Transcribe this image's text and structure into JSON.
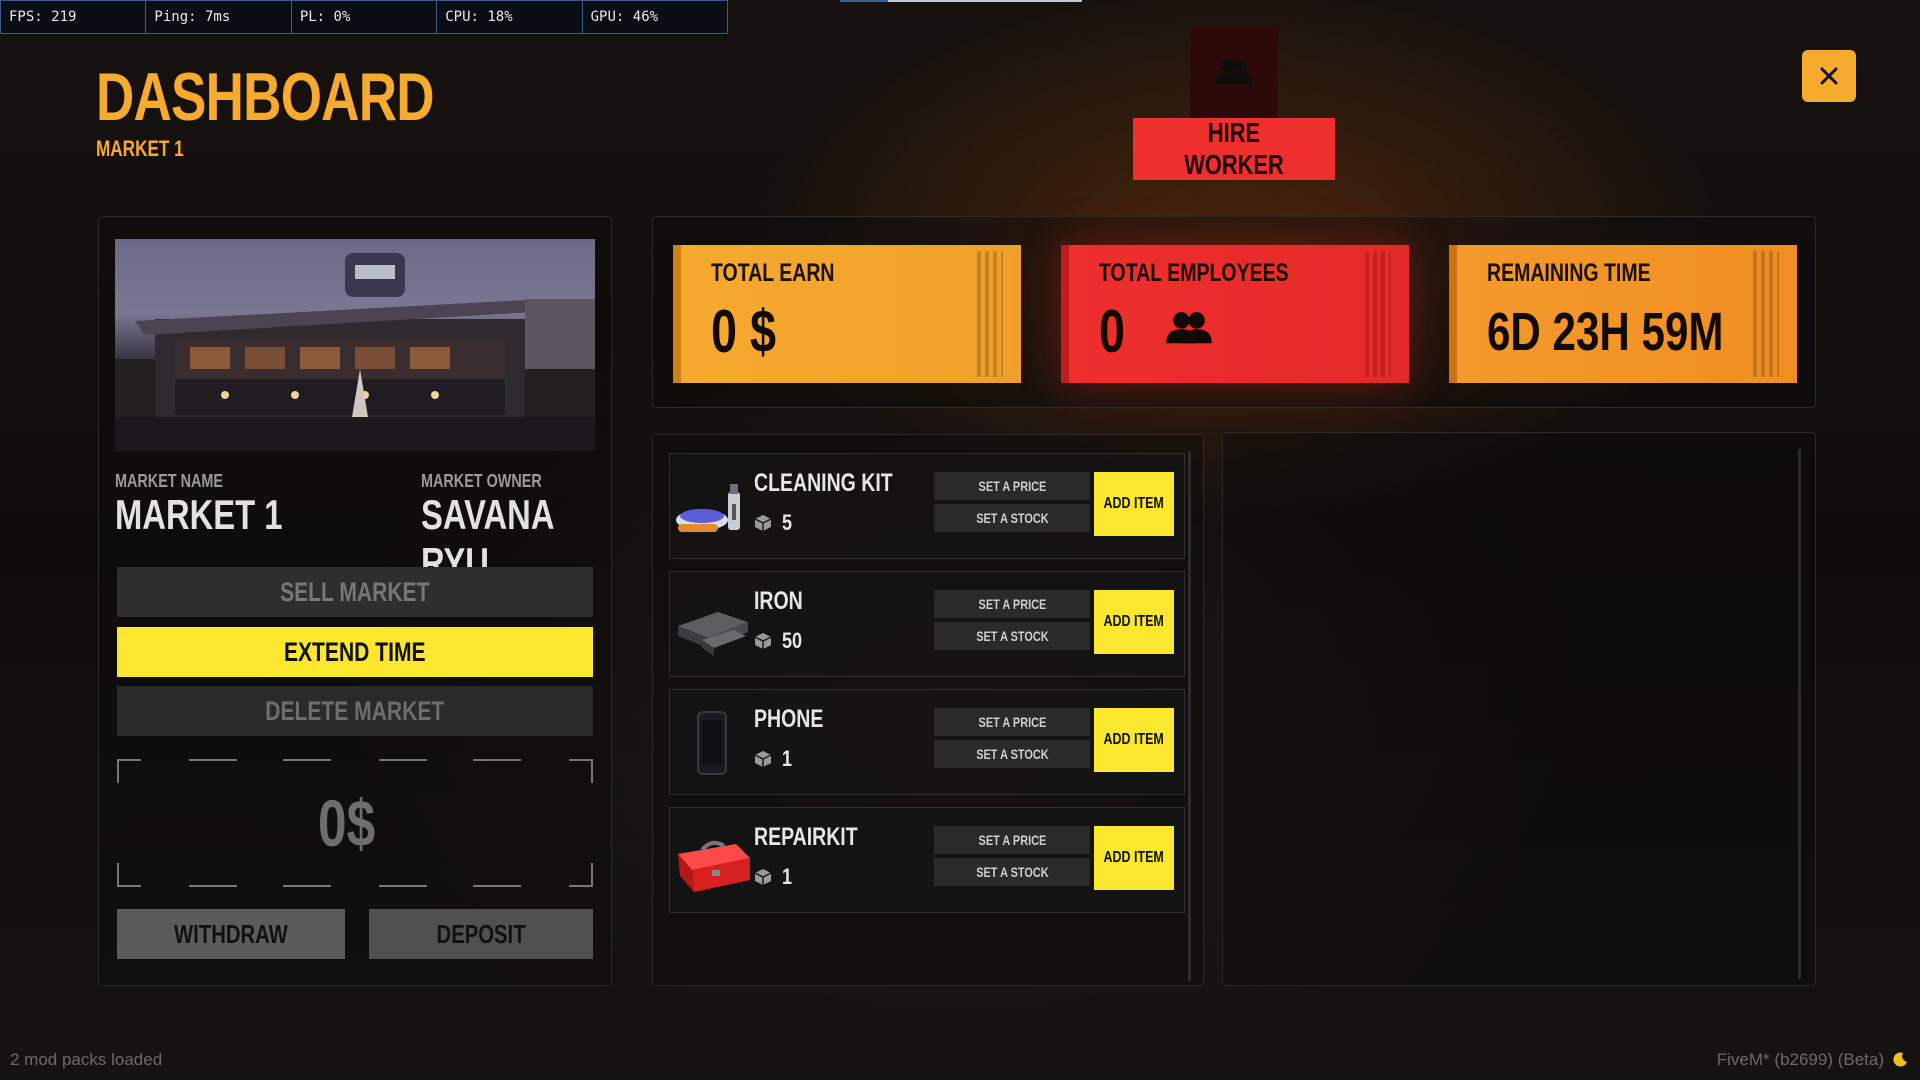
{
  "perf": {
    "fps": "FPS: 219",
    "ping": "Ping: 7ms",
    "pl": "PL: 0%",
    "cpu": "CPU: 18%",
    "gpu": "GPU: 46%"
  },
  "header": {
    "title": "DASHBOARD",
    "subtitle": "MARKET 1",
    "hire_label": "HIRE WORKER"
  },
  "market": {
    "name_label": "MARKET NAME",
    "name": "MARKET 1",
    "owner_label": "MARKET OWNER",
    "owner": "SAVANA RYU",
    "sell_label": "SELL MARKET",
    "extend_label": "EXTEND TIME",
    "delete_label": "DELETE MARKET",
    "balance": "0$",
    "withdraw_label": "WITHDRAW",
    "deposit_label": "DEPOSIT"
  },
  "stats": {
    "earn_label": "TOTAL EARN",
    "earn_value": "0 $",
    "employees_label": "TOTAL EMPLOYEES",
    "employees_value": "0",
    "time_label": "REMAINING TIME",
    "time_value": "6D 23H 59M"
  },
  "items": [
    {
      "name": "CLEANING KIT",
      "qty": "5",
      "icon": "cleaning-kit-icon",
      "price_label": "SET A PRICE",
      "stock_label": "SET A STOCK",
      "add_label": "ADD ITEM"
    },
    {
      "name": "IRON",
      "qty": "50",
      "icon": "iron-icon",
      "price_label": "SET A PRICE",
      "stock_label": "SET A STOCK",
      "add_label": "ADD ITEM"
    },
    {
      "name": "PHONE",
      "qty": "1",
      "icon": "phone-icon",
      "price_label": "SET A PRICE",
      "stock_label": "SET A STOCK",
      "add_label": "ADD ITEM"
    },
    {
      "name": "REPAIRKIT",
      "qty": "1",
      "icon": "repair-kit-icon",
      "price_label": "SET A PRICE",
      "stock_label": "SET A STOCK",
      "add_label": "ADD ITEM"
    }
  ],
  "footer": {
    "mods": "2 mod packs loaded",
    "version": "FiveM* (b2699) (Beta)"
  },
  "colors": {
    "accent_orange": "#f7ab2e",
    "accent_red": "#ee2f2e",
    "accent_yellow": "#fbe72d"
  }
}
